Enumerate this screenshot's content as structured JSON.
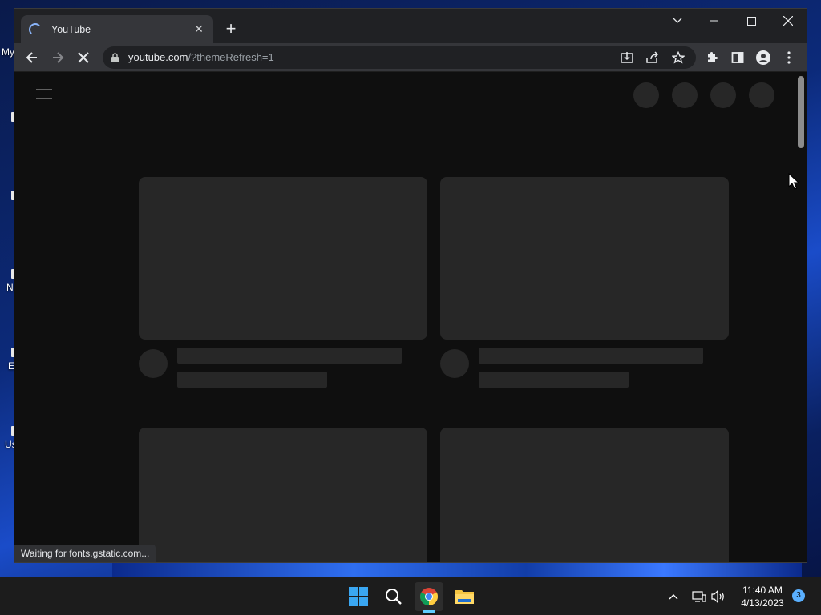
{
  "desktop": {
    "icons": [
      {
        "label": "My"
      },
      {
        "label": "N"
      },
      {
        "label": "E"
      },
      {
        "label": "Us"
      }
    ]
  },
  "browser": {
    "tab": {
      "title": "YouTube",
      "loading": true
    },
    "omnibox": {
      "url_host": "youtube.com",
      "url_rest": "/?themeRefresh=1"
    },
    "status_text": "Waiting for fonts.gstatic.com..."
  },
  "taskbar": {
    "apps": [
      "start-icon",
      "search-icon",
      "chrome-icon",
      "file-explorer-icon"
    ],
    "clock": {
      "time": "11:40 AM",
      "date": "4/13/2023"
    },
    "notification_count": "3"
  },
  "colors": {
    "page_bg": "#0f0f0f",
    "skeleton": "#272727",
    "chrome_frame": "#202124",
    "chrome_toolbar": "#35363a",
    "taskbar": "#1c1c1c",
    "accent": "#60cdff"
  }
}
